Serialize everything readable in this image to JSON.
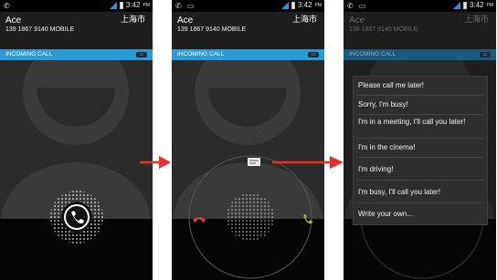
{
  "status": {
    "time": "3:42",
    "ampm": "PM"
  },
  "caller": {
    "name": "Ace",
    "number": "139 1867 9140 MOBILE",
    "location": "上海市"
  },
  "incoming_label": "INCOMING CALL",
  "quick_replies": [
    "Please call me later!",
    "Sorry, I'm busy!",
    "I'm in a meeting, I'll call you later!",
    "I'm in the cinema!",
    "I'm driving!",
    "I'm busy, I'll call you later!",
    "Write your own..."
  ],
  "colors": {
    "accent": "#2a9bd6",
    "decline": "#d93a3a",
    "answer": "#7fc43b",
    "arrow": "#e8312b"
  }
}
